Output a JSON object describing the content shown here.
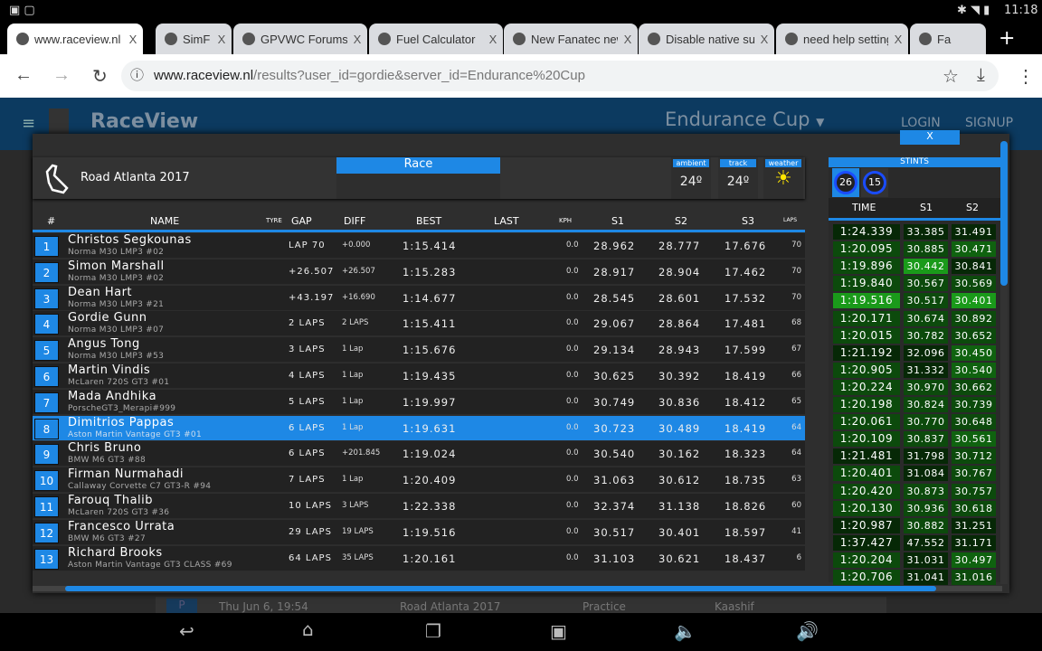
{
  "statusbar": {
    "time": "11:18"
  },
  "tabs": [
    {
      "label": "www.raceview.nl",
      "active": true
    },
    {
      "label": "SimF"
    },
    {
      "label": "GPVWC Forums"
    },
    {
      "label": "Fuel Calculator"
    },
    {
      "label": "New Fanatec new"
    },
    {
      "label": "Disable native su"
    },
    {
      "label": "need help setting"
    },
    {
      "label": "Fa"
    }
  ],
  "address": {
    "host": "www.raceview.nl",
    "path": "/results?user_id=gordie&server_id=Endurance%20Cup"
  },
  "site": {
    "logo": "RaceView",
    "series": "Endurance Cup",
    "login": "LOGIN",
    "signup": "SIGNUP"
  },
  "session": {
    "close": "X",
    "track": "Road Atlanta 2017",
    "type": "Race",
    "ambient_label": "ambient",
    "ambient": "24º",
    "track_label": "track",
    "track_temp": "24º",
    "weather_label": "weather",
    "weather_icon": "sun-icon"
  },
  "table": {
    "headers": {
      "pos": "#",
      "name": "NAME",
      "tyre": "TYRE",
      "gap": "GAP",
      "diff": "DIFF",
      "best": "BEST",
      "last": "LAST",
      "kph": "KPH",
      "s1": "S1",
      "s2": "S2",
      "s3": "S3",
      "laps": "LAPS"
    },
    "rows": [
      {
        "pos": "1",
        "name": "Christos Segkounas",
        "car": "Norma M30 LMP3 #02",
        "gap": "LAP 70",
        "diff": "+0.000",
        "best": "1:15.414",
        "kph": "0.0",
        "s1": "28.962",
        "s2": "28.777",
        "s3": "17.676",
        "laps": "70"
      },
      {
        "pos": "2",
        "name": "Simon Marshall",
        "car": "Norma M30 LMP3 #02",
        "gap": "+26.507",
        "diff": "+26.507",
        "best": "1:15.283",
        "kph": "0.0",
        "s1": "28.917",
        "s2": "28.904",
        "s3": "17.462",
        "laps": "70"
      },
      {
        "pos": "3",
        "name": "Dean Hart",
        "car": "Norma M30 LMP3 #21",
        "gap": "+43.197",
        "diff": "+16.690",
        "best": "1:14.677",
        "kph": "0.0",
        "s1": "28.545",
        "s2": "28.601",
        "s3": "17.532",
        "laps": "70"
      },
      {
        "pos": "4",
        "name": "Gordie Gunn",
        "car": "Norma M30 LMP3 #07",
        "gap": "2 LAPS",
        "diff": "2 LAPS",
        "best": "1:15.411",
        "kph": "0.0",
        "s1": "29.067",
        "s2": "28.864",
        "s3": "17.481",
        "laps": "68"
      },
      {
        "pos": "5",
        "name": "Angus Tong",
        "car": "Norma M30 LMP3 #53",
        "gap": "3 LAPS",
        "diff": "1 Lap",
        "best": "1:15.676",
        "kph": "0.0",
        "s1": "29.134",
        "s2": "28.943",
        "s3": "17.599",
        "laps": "67"
      },
      {
        "pos": "6",
        "name": "Martin Vindis",
        "car": "McLaren 720S GT3 #01",
        "gap": "4 LAPS",
        "diff": "1 Lap",
        "best": "1:19.435",
        "kph": "0.0",
        "s1": "30.625",
        "s2": "30.392",
        "s3": "18.419",
        "laps": "66"
      },
      {
        "pos": "7",
        "name": "Mada Andhika",
        "car": "PorscheGT3_Merapi#999",
        "gap": "5 LAPS",
        "diff": "1 Lap",
        "best": "1:19.997",
        "kph": "0.0",
        "s1": "30.749",
        "s2": "30.836",
        "s3": "18.412",
        "laps": "65"
      },
      {
        "pos": "8",
        "name": "Dimitrios Pappas",
        "car": "Aston Martin Vantage GT3 #01",
        "gap": "6 LAPS",
        "diff": "1 Lap",
        "best": "1:19.631",
        "kph": "0.0",
        "s1": "30.723",
        "s2": "30.489",
        "s3": "18.419",
        "laps": "64",
        "selected": true
      },
      {
        "pos": "9",
        "name": "Chris Bruno",
        "car": "BMW M6 GT3 #88",
        "gap": "6 LAPS",
        "diff": "+201.845",
        "best": "1:19.024",
        "kph": "0.0",
        "s1": "30.540",
        "s2": "30.162",
        "s3": "18.323",
        "laps": "64"
      },
      {
        "pos": "10",
        "name": "Firman Nurmahadi",
        "car": "Callaway Corvette C7 GT3-R #94",
        "gap": "7 LAPS",
        "diff": "1 Lap",
        "best": "1:20.409",
        "kph": "0.0",
        "s1": "31.063",
        "s2": "30.612",
        "s3": "18.735",
        "laps": "63"
      },
      {
        "pos": "11",
        "name": "Farouq Thalib",
        "car": "McLaren 720S GT3 #36",
        "gap": "10 LAPS",
        "diff": "3 LAPS",
        "best": "1:22.338",
        "kph": "0.0",
        "s1": "32.374",
        "s2": "31.138",
        "s3": "18.826",
        "laps": "60"
      },
      {
        "pos": "12",
        "name": "Francesco Urrata",
        "car": "BMW M6 GT3 #27",
        "gap": "29 LAPS",
        "diff": "19 LAPS",
        "best": "1:19.516",
        "kph": "0.0",
        "s1": "30.517",
        "s2": "30.401",
        "s3": "18.597",
        "laps": "41"
      },
      {
        "pos": "13",
        "name": "Richard Brooks",
        "car": "Aston Martin Vantage GT3 CLASS #69",
        "gap": "64 LAPS",
        "diff": "35 LAPS",
        "best": "1:20.161",
        "kph": "0.0",
        "s1": "31.103",
        "s2": "30.621",
        "s3": "18.437",
        "laps": "6"
      }
    ]
  },
  "stints": {
    "title": "STINTS",
    "chips": [
      "26",
      "15"
    ],
    "headers": {
      "time": "TIME",
      "s1": "S1",
      "s2": "S2"
    },
    "shade_colors": [
      "#062806",
      "#0c4a0c",
      "#0f620f",
      "#1a9a1a"
    ],
    "laps": [
      {
        "time": "1:24.339",
        "s1": "33.385",
        "s2": "31.491",
        "shade": [
          0,
          0,
          0
        ]
      },
      {
        "time": "1:20.095",
        "s1": "30.885",
        "s2": "30.471",
        "shade": [
          1,
          1,
          2
        ]
      },
      {
        "time": "1:19.896",
        "s1": "30.442",
        "s2": "30.841",
        "shade": [
          1,
          3,
          0
        ]
      },
      {
        "time": "1:19.840",
        "s1": "30.567",
        "s2": "30.569",
        "shade": [
          1,
          1,
          1
        ]
      },
      {
        "time": "1:19.516",
        "s1": "30.517",
        "s2": "30.401",
        "shade": [
          3,
          1,
          3
        ]
      },
      {
        "time": "1:20.171",
        "s1": "30.674",
        "s2": "30.892",
        "shade": [
          1,
          1,
          1
        ]
      },
      {
        "time": "1:20.015",
        "s1": "30.782",
        "s2": "30.652",
        "shade": [
          1,
          1,
          1
        ]
      },
      {
        "time": "1:21.192",
        "s1": "32.096",
        "s2": "30.450",
        "shade": [
          0,
          0,
          2
        ]
      },
      {
        "time": "1:20.905",
        "s1": "31.332",
        "s2": "30.540",
        "shade": [
          1,
          0,
          2
        ]
      },
      {
        "time": "1:20.224",
        "s1": "30.970",
        "s2": "30.662",
        "shade": [
          1,
          1,
          1
        ]
      },
      {
        "time": "1:20.198",
        "s1": "30.824",
        "s2": "30.739",
        "shade": [
          1,
          1,
          1
        ]
      },
      {
        "time": "1:20.061",
        "s1": "30.770",
        "s2": "30.648",
        "shade": [
          1,
          1,
          1
        ]
      },
      {
        "time": "1:20.109",
        "s1": "30.837",
        "s2": "30.561",
        "shade": [
          1,
          1,
          2
        ]
      },
      {
        "time": "1:21.481",
        "s1": "31.798",
        "s2": "30.712",
        "shade": [
          0,
          0,
          1
        ]
      },
      {
        "time": "1:20.401",
        "s1": "31.084",
        "s2": "30.767",
        "shade": [
          1,
          0,
          1
        ]
      },
      {
        "time": "1:20.420",
        "s1": "30.873",
        "s2": "30.757",
        "shade": [
          1,
          1,
          1
        ]
      },
      {
        "time": "1:20.130",
        "s1": "30.936",
        "s2": "30.618",
        "shade": [
          1,
          1,
          1
        ]
      },
      {
        "time": "1:20.987",
        "s1": "30.882",
        "s2": "31.251",
        "shade": [
          0,
          1,
          0
        ]
      },
      {
        "time": "1:37.427",
        "s1": "47.552",
        "s2": "31.171",
        "shade": [
          0,
          0,
          0
        ]
      },
      {
        "time": "1:20.204",
        "s1": "31.031",
        "s2": "30.497",
        "shade": [
          1,
          0,
          2
        ]
      },
      {
        "time": "1:20.706",
        "s1": "31.041",
        "s2": "31.016",
        "shade": [
          1,
          0,
          1
        ]
      }
    ]
  },
  "background_row": {
    "badge": "P",
    "date": "Thu Jun 6, 19:54",
    "track": "Road Atlanta 2017",
    "session": "Practice",
    "driver": "Kaashif"
  },
  "colors": {
    "accent": "#1e88e5",
    "header": "#0c3a60"
  }
}
